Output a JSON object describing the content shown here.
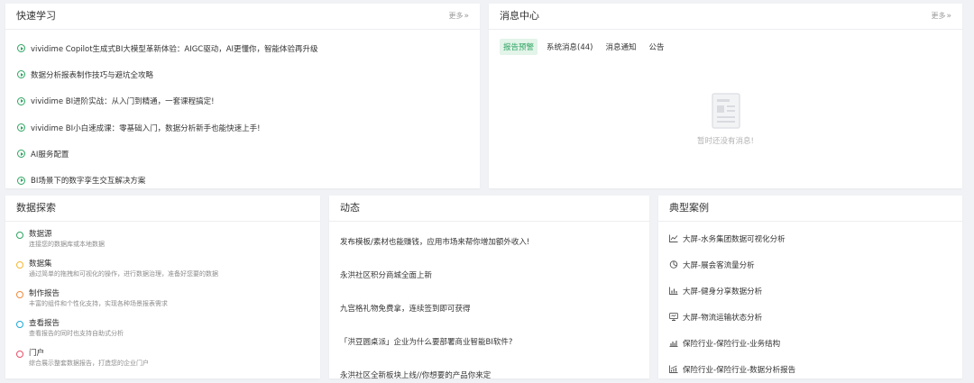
{
  "quick_learning": {
    "title": "快速学习",
    "more": "更多",
    "courses": [
      "vividime Copilot生成式BI大模型革新体验：AIGC驱动，AI更懂你，智能体验再升级",
      "数据分析报表制作技巧与避坑全攻略",
      "vividime BI进阶实战：从入门到精通，一套课程搞定!",
      "vividime BI小白速成课：零基础入门，数据分析新手也能快速上手!",
      "AI服务配置",
      "BI场景下的数字孪生交互解决方案"
    ]
  },
  "message_center": {
    "title": "消息中心",
    "more": "更多",
    "tabs": [
      "报告预警",
      "系统消息(44)",
      "消息通知",
      "公告"
    ],
    "active_tab": 0,
    "empty_text": "暂时还没有消息!"
  },
  "data_explore": {
    "title": "数据探索",
    "items": [
      {
        "title": "数据源",
        "desc": "连接您的数据库或本地数据",
        "color": "#2ea462"
      },
      {
        "title": "数据集",
        "desc": "通过简单的拖拽和可视化的操作，进行数据治理，准备好您要的数据",
        "color": "#f5b731"
      },
      {
        "title": "制作报告",
        "desc": "丰富的组件和个性化支持，实现各种场景报表需求",
        "color": "#f08a3c"
      },
      {
        "title": "查看报告",
        "desc": "查看报告的同时也支持自助式分析",
        "color": "#21a8d8"
      },
      {
        "title": "门户",
        "desc": "综合展示整套数据报告，打造您的企业门户",
        "color": "#e94f6a"
      }
    ]
  },
  "news": {
    "title": "动态",
    "items": [
      "发布模板/素材也能赚钱，应用市场来帮你增加额外收入!",
      "永洪社区积分商城全面上新",
      "九宫格礼物免费拿，连续签到即可获得",
      "「洪豆圆桌派」企业为什么要部署商业智能BI软件?",
      "永洪社区全新板块上线//你想要的产品你来定"
    ]
  },
  "cases": {
    "title": "典型案例",
    "items": [
      {
        "icon": "line-chart-icon",
        "label": "大屏-水务集团数据可视化分析"
      },
      {
        "icon": "pie-chart-icon",
        "label": "大屏-展会客流量分析"
      },
      {
        "icon": "bar-chart-icon",
        "label": "大屏-健身分享数据分析"
      },
      {
        "icon": "monitor-icon",
        "label": "大屏-物流运输状态分析"
      },
      {
        "icon": "column-chart-icon",
        "label": "保险行业-保险行业-业务结构"
      },
      {
        "icon": "trend-chart-icon",
        "label": "保险行业-保险行业-数据分析报告"
      }
    ]
  },
  "colors": {
    "accent": "#2ea462"
  }
}
